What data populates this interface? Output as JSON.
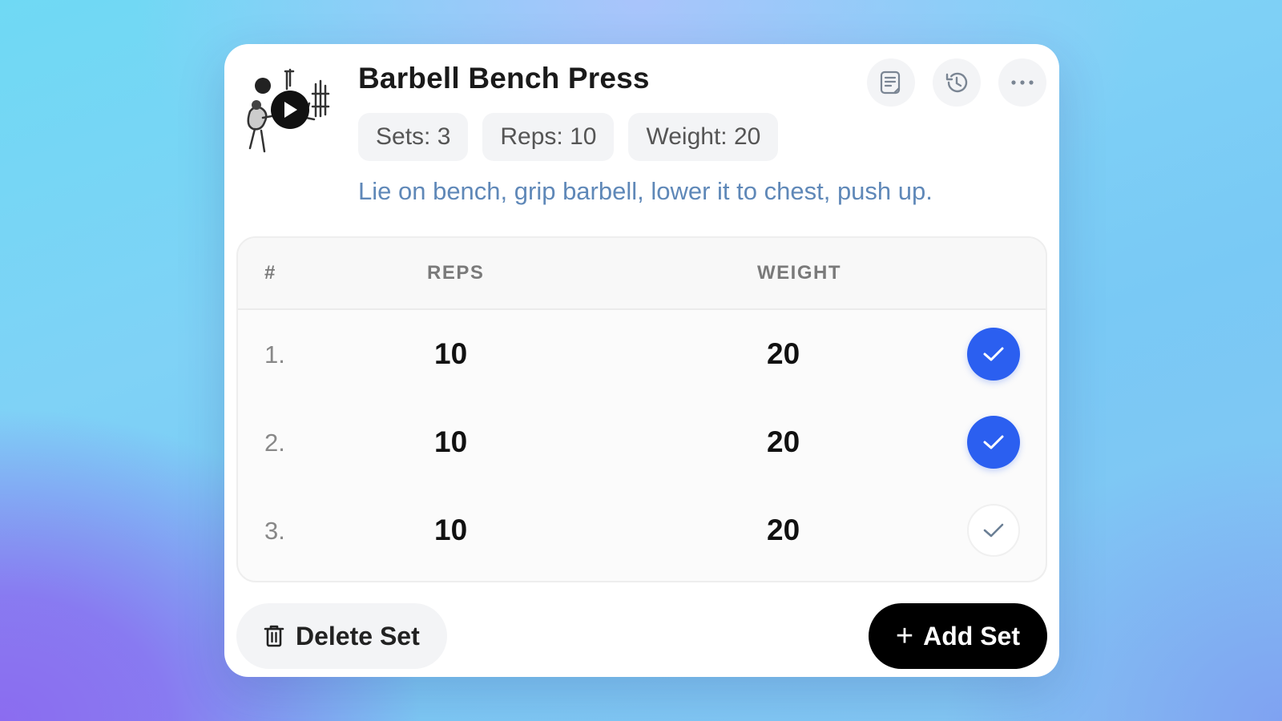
{
  "exercise": {
    "title": "Barbell Bench Press",
    "description": "Lie on bench, grip barbell, lower it to chest, push up.",
    "chips": [
      {
        "label": "Sets: 3"
      },
      {
        "label": "Reps: 10"
      },
      {
        "label": "Weight: 20"
      }
    ],
    "thumbnail_icon": "exercise-illustration",
    "play_icon": "play-icon"
  },
  "toolbar": {
    "icons": [
      "notes-icon",
      "history-icon",
      "more-icon"
    ]
  },
  "table": {
    "headers": {
      "num": "#",
      "reps": "REPS",
      "weight": "WEIGHT"
    },
    "rows": [
      {
        "num": "1.",
        "reps": "10",
        "weight": "20",
        "completed": true
      },
      {
        "num": "2.",
        "reps": "10",
        "weight": "20",
        "completed": true
      },
      {
        "num": "3.",
        "reps": "10",
        "weight": "20",
        "completed": false
      }
    ]
  },
  "actions": {
    "delete_label": "Delete Set",
    "add_label": "Add Set",
    "plus_glyph": "+"
  },
  "colors": {
    "accent": "#2b5ff0",
    "description": "#5f88b8",
    "primary_button": "#000000"
  }
}
